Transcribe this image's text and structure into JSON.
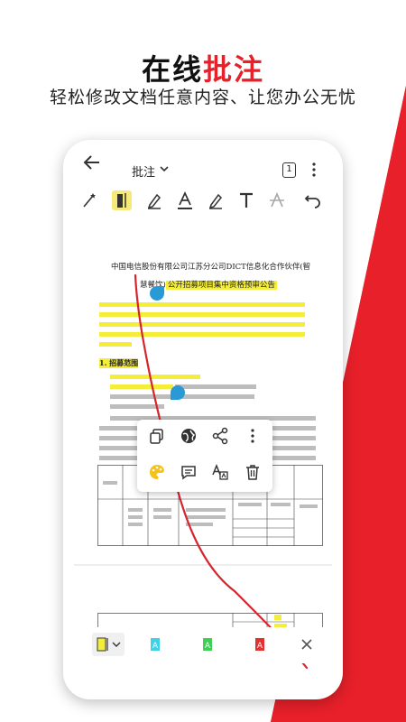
{
  "headline": {
    "part1": "在线",
    "part2": "批注"
  },
  "subline": "轻松修改文档任意内容、让您办公无忧",
  "app": {
    "mode_title": "批注",
    "page_badge": "1"
  },
  "document": {
    "title_line1": "中国电信股份有限公司江苏分公司DICT信息化合作伙伴(智",
    "title_line2_a": "慧餐饮)",
    "title_line2_b": "公开招募项目集中资格预审公告",
    "section_heading": "1. 招募范围"
  },
  "colors": {
    "accent": "#e8202a",
    "highlight": "#f4ee3b",
    "ink_blue": "#2a9ad6",
    "swatch_yellow": "#f4ee3b",
    "swatch_cyan": "#3fd1e6",
    "swatch_green": "#3fcf55",
    "swatch_red": "#e23232"
  }
}
